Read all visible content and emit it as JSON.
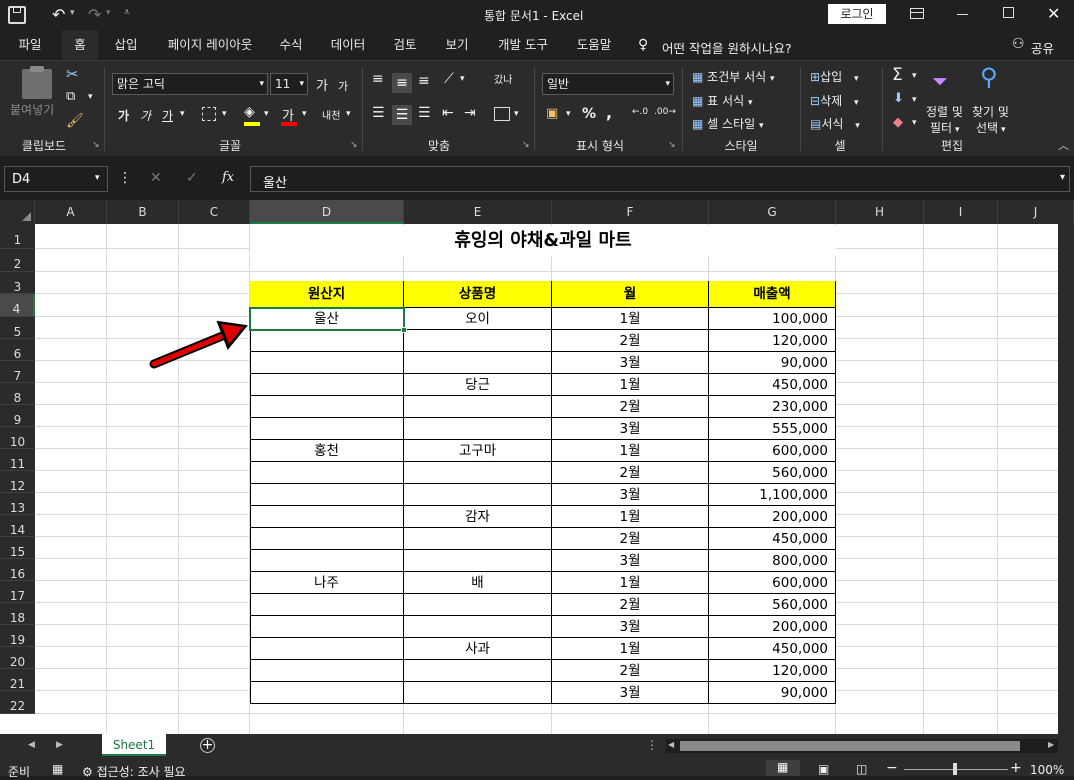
{
  "titlebar": {
    "doc_title": "통합 문서1  -  Excel",
    "login": "로그인"
  },
  "menu": {
    "tabs": [
      "파일",
      "홈",
      "삽입",
      "페이지 레이아웃",
      "수식",
      "데이터",
      "검토",
      "보기",
      "개발 도구",
      "도움말"
    ],
    "search_hint": "어떤 작업을 원하시나요?",
    "share": "공유"
  },
  "ribbon": {
    "clipboard": {
      "paste": "붙여넣기",
      "label": "클립보드"
    },
    "font": {
      "name": "맑은 고딕",
      "size": "11",
      "label": "글꼴",
      "grow": "가",
      "shrink": "가",
      "bold": "가",
      "italic": "가",
      "underline": "가",
      "phonetic": "내천"
    },
    "align": {
      "label": "맞춤",
      "wrap": "갔나"
    },
    "number": {
      "format": "일반",
      "label": "표시 형식",
      "percent": "%",
      "comma": ","
    },
    "styles": {
      "cond": "조건부 서식",
      "table": "표 서식",
      "cell": "셀 스타일",
      "label": "스타일"
    },
    "cells": {
      "insert": "삽입",
      "delete": "삭제",
      "format": "서식",
      "label": "셀"
    },
    "editing": {
      "sort": "정렬 및",
      "sort2": "필터",
      "find": "찾기 및",
      "find2": "선택",
      "label": "편집"
    }
  },
  "formula": {
    "namebox": "D4",
    "fx": "fx",
    "value": "울산"
  },
  "columns": [
    "A",
    "B",
    "C",
    "D",
    "E",
    "F",
    "G",
    "H",
    "I",
    "J"
  ],
  "rows": [
    "1",
    "2",
    "3",
    "4",
    "5",
    "6",
    "7",
    "8",
    "9",
    "10",
    "11",
    "12",
    "13",
    "14",
    "15",
    "16",
    "17",
    "18",
    "19",
    "20",
    "21",
    "22"
  ],
  "sheet": {
    "title": "휴잉의 야채&과일 마트",
    "headers": [
      "원산지",
      "상품명",
      "월",
      "매출액"
    ],
    "data": [
      [
        "울산",
        "오이",
        "1월",
        "100,000"
      ],
      [
        "",
        "",
        "2월",
        "120,000"
      ],
      [
        "",
        "",
        "3월",
        "90,000"
      ],
      [
        "",
        "당근",
        "1월",
        "450,000"
      ],
      [
        "",
        "",
        "2월",
        "230,000"
      ],
      [
        "",
        "",
        "3월",
        "555,000"
      ],
      [
        "홍천",
        "고구마",
        "1월",
        "600,000"
      ],
      [
        "",
        "",
        "2월",
        "560,000"
      ],
      [
        "",
        "",
        "3월",
        "1,100,000"
      ],
      [
        "",
        "감자",
        "1월",
        "200,000"
      ],
      [
        "",
        "",
        "2월",
        "450,000"
      ],
      [
        "",
        "",
        "3월",
        "800,000"
      ],
      [
        "나주",
        "배",
        "1월",
        "600,000"
      ],
      [
        "",
        "",
        "2월",
        "560,000"
      ],
      [
        "",
        "",
        "3월",
        "200,000"
      ],
      [
        "",
        "사과",
        "1월",
        "450,000"
      ],
      [
        "",
        "",
        "2월",
        "120,000"
      ],
      [
        "",
        "",
        "3월",
        "90,000"
      ]
    ],
    "header_fill": "#ffff00"
  },
  "tabs": {
    "sheet1": "Sheet1"
  },
  "status": {
    "ready": "준비",
    "access": "접근성: 조사 필요",
    "zoom": "100%"
  },
  "accent": "#1d7a45",
  "arrow_color": "#e00000"
}
